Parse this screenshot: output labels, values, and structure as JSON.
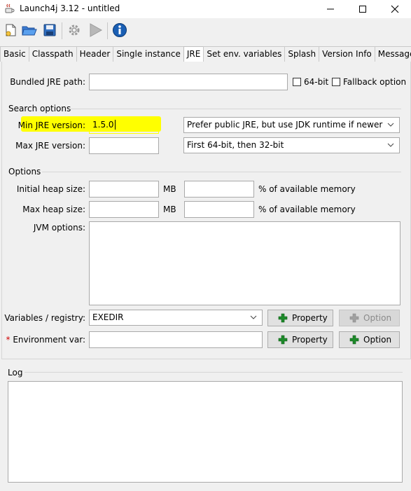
{
  "window": {
    "title": "Launch4j 3.12 - untitled",
    "controls": [
      "minimize",
      "maximize",
      "close"
    ]
  },
  "toolbar": {
    "items": [
      {
        "name": "new-config",
        "icon": "new-file-icon"
      },
      {
        "name": "open-config",
        "icon": "folder-open-icon"
      },
      {
        "name": "save-config",
        "icon": "save-icon"
      },
      {
        "name": "build-wrapper",
        "icon": "gear-icon",
        "disabled": true
      },
      {
        "name": "test-wrapper",
        "icon": "play-icon",
        "disabled": true
      },
      {
        "name": "about",
        "icon": "info-icon"
      }
    ]
  },
  "tabs": [
    "Basic",
    "Classpath",
    "Header",
    "Single instance",
    "JRE",
    "Set env. variables",
    "Splash",
    "Version Info",
    "Messages"
  ],
  "active_tab": "JRE",
  "jre": {
    "bundled_path_label": "Bundled JRE path:",
    "bundled_path_value": "",
    "bit64_label": "64-bit",
    "fallback_label": "Fallback option",
    "search_options_title": "Search options",
    "min_version_label": "Min JRE version:",
    "min_version_value": "1.5.0",
    "max_version_label": "Max JRE version:",
    "max_version_value": "",
    "jdk_preference": "Prefer public JRE, but use JDK runtime if newer",
    "runtime_bits": "First 64-bit, then 32-bit",
    "options_title": "Options",
    "initial_heap_label": "Initial heap size:",
    "initial_heap_value": "",
    "max_heap_label": "Max heap size:",
    "max_heap_value": "",
    "mb_unit": "MB",
    "percent_label": "% of available memory",
    "jvm_options_label": "JVM options:",
    "jvm_options_value": "",
    "variables_label": "Variables / registry:",
    "variables_value": "EXEDIR",
    "property_label": "Property",
    "option_label": "Option",
    "env_var_required_mark": "*",
    "env_var_label": "Environment var:",
    "env_var_value": ""
  },
  "log": {
    "title": "Log",
    "content": ""
  },
  "colors": {
    "highlight": "#ffff00",
    "plus_green": "#1d8a2a",
    "info_blue": "#1a5fb4"
  }
}
